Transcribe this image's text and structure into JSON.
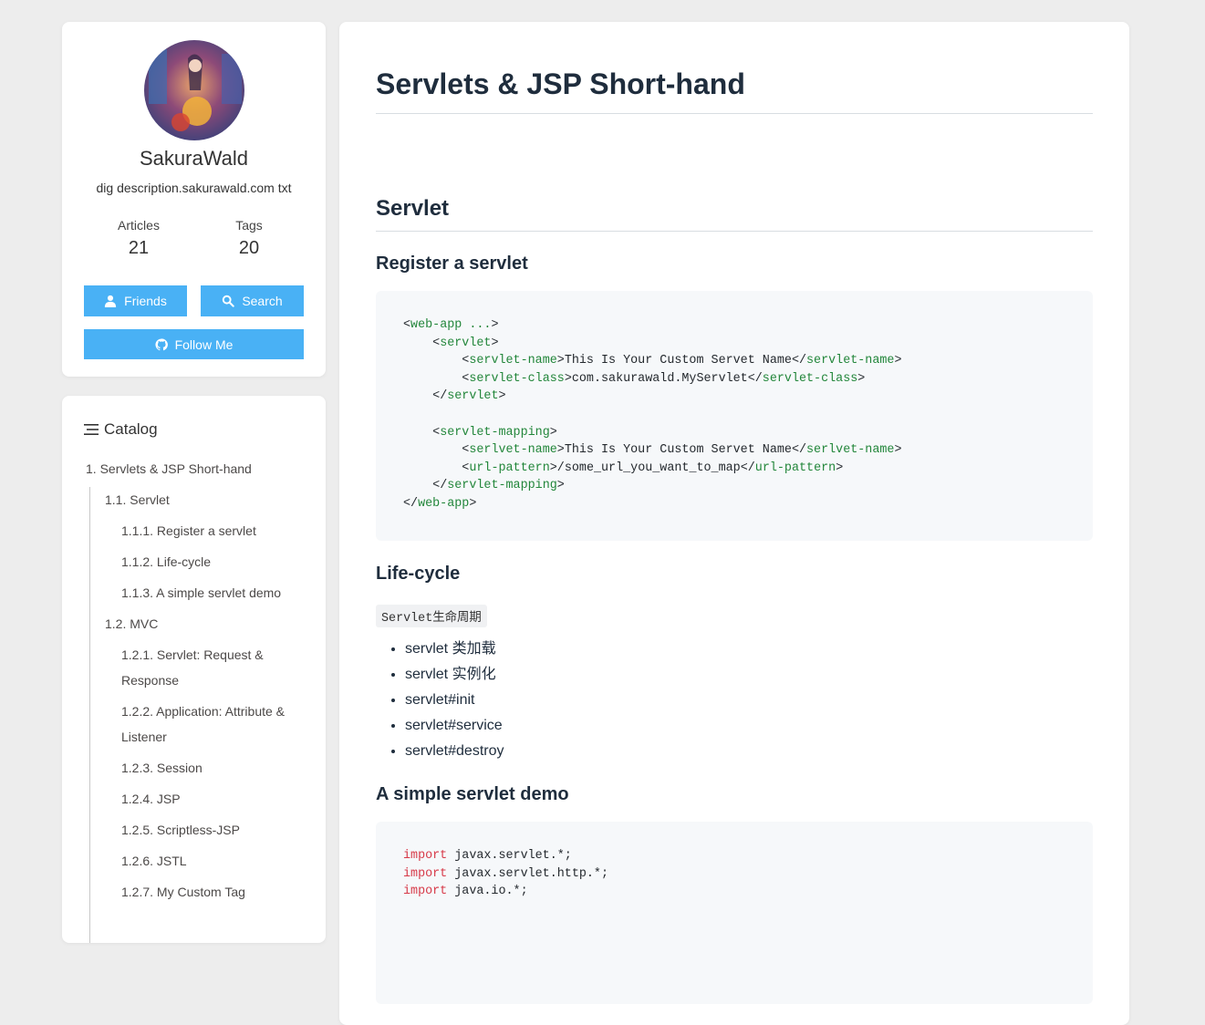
{
  "profile": {
    "name": "SakuraWald",
    "description": "dig description.sakurawald.com txt",
    "articles_label": "Articles",
    "articles_count": "21",
    "tags_label": "Tags",
    "tags_count": "20",
    "friends_label": "Friends",
    "search_label": "Search",
    "follow_label": "Follow Me"
  },
  "catalog": {
    "title": "Catalog",
    "items": [
      "1. Servlets & JSP Short-hand",
      "1.1. Servlet",
      "1.1.1. Register a servlet",
      "1.1.2. Life-cycle",
      "1.1.3. A simple servlet demo",
      "1.2. MVC",
      "1.2.1. Servlet: Request & Response",
      "1.2.2. Application: Attribute & Listener",
      "1.2.3. Session",
      "1.2.4. JSP",
      "1.2.5. Scriptless-JSP",
      "1.2.6. JSTL",
      "1.2.7. My Custom Tag"
    ]
  },
  "post": {
    "title": "Servlets & JSP Short-hand",
    "h_servlet": "Servlet",
    "h_register": "Register a servlet",
    "h_lifecycle": "Life-cycle",
    "lifecycle_code": "Servlet生命周期",
    "lifecycle_items": [
      "servlet 类加载",
      "servlet 实例化",
      "servlet#init",
      "servlet#service",
      "servlet#destroy"
    ],
    "h_demo": "A simple servlet demo",
    "code1": [
      {
        "indent": "",
        "open": "<",
        "tag": "web-app ...",
        "close": ">",
        "text": "",
        "etag": ""
      },
      {
        "indent": "    ",
        "open": "<",
        "tag": "servlet",
        "close": ">",
        "text": "",
        "etag": ""
      },
      {
        "indent": "        ",
        "open": "<",
        "tag": "servlet-name",
        "close": ">",
        "text": "This Is Your Custom Servet Name",
        "etag": "servlet-name"
      },
      {
        "indent": "        ",
        "open": "<",
        "tag": "servlet-class",
        "close": ">",
        "text": "com.sakurawald.MyServlet",
        "etag": "servlet-class"
      },
      {
        "indent": "    ",
        "open": "</",
        "tag": "servlet",
        "close": ">",
        "text": "",
        "etag": ""
      },
      {
        "indent": "",
        "open": "",
        "tag": "",
        "close": "",
        "text": "",
        "etag": ""
      },
      {
        "indent": "    ",
        "open": "<",
        "tag": "servlet-mapping",
        "close": ">",
        "text": "",
        "etag": ""
      },
      {
        "indent": "        ",
        "open": "<",
        "tag": "serlvet-name",
        "close": ">",
        "text": "This Is Your Custom Servet Name",
        "etag": "serlvet-name"
      },
      {
        "indent": "        ",
        "open": "<",
        "tag": "url-pattern",
        "close": ">",
        "text": "/some_url_you_want_to_map",
        "etag": "url-pattern"
      },
      {
        "indent": "    ",
        "open": "</",
        "tag": "servlet-mapping",
        "close": ">",
        "text": "",
        "etag": ""
      },
      {
        "indent": "",
        "open": "</",
        "tag": "web-app",
        "close": ">",
        "text": "",
        "etag": ""
      }
    ],
    "code2": [
      {
        "kw": "import",
        "rest": " javax.servlet.*;"
      },
      {
        "kw": "import",
        "rest": " javax.servlet.http.*;"
      },
      {
        "kw": "import",
        "rest": " java.io.*;"
      }
    ]
  }
}
